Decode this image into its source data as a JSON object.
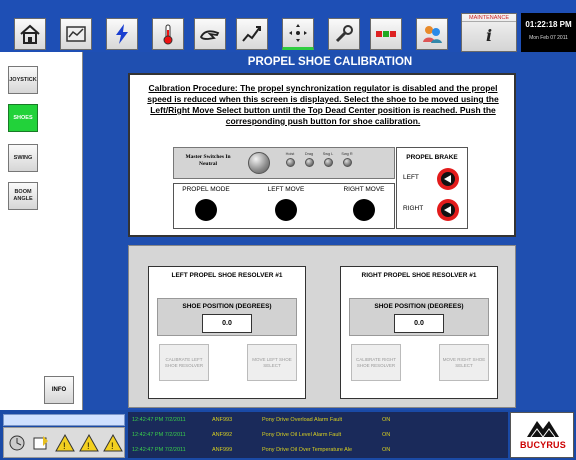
{
  "toolbar": {
    "buttons": [
      "home-icon",
      "chart-panel-icon",
      "lightning-icon",
      "thermometer-icon",
      "hand-icon",
      "trend-icon",
      "move-arrows-icon",
      "wrench-icon",
      "signal-lights-icon",
      "people-icon"
    ],
    "maintenance_label": "MAINTENANCE",
    "info_glyph": "i",
    "time": "01:22:18 PM",
    "date": "Mon Feb 07 2011"
  },
  "sidebar": {
    "items": [
      {
        "label": "JOYSTICK",
        "active": false
      },
      {
        "label": "SHOES",
        "active": true
      },
      {
        "label": "SWING",
        "active": false
      },
      {
        "label": "BOOM ANGLE",
        "active": false
      }
    ],
    "info_label": "INFO"
  },
  "page": {
    "title": "PROPEL SHOE CALIBRATION",
    "procedure": "Calbration Procedure: The propel synchronization regulator is disabled and the propel speed is reduced when this screen is displayed. Select the shoe to be moved using the Left/Right Move Select button until the Top Dead Center position is reached. Push the corresponding push button for shoe calibration."
  },
  "master": {
    "label": "Master Switches In Neutral",
    "lamps": [
      "Hoist",
      "Drag",
      "Swg L",
      "Swg R"
    ]
  },
  "modes": {
    "propel_mode": "PROPEL MODE",
    "left_move": "LEFT MOVE",
    "right_move": "RIGHT MOVE"
  },
  "brake": {
    "title": "PROPEL BRAKE",
    "left": "LEFT",
    "right": "RIGHT"
  },
  "resolvers": {
    "left": {
      "title": "LEFT PROPEL SHOE RESOLVER #1",
      "pos_label": "SHOE POSITION (DEGREES)",
      "value": "0.0",
      "calibrate": "CALIBRATE LEFT SHOE RESOLVER",
      "move": "MOVE LEFT SHOE SELECT"
    },
    "right": {
      "title": "RIGHT PROPEL SHOE RESOLVER #1",
      "pos_label": "SHOE POSITION (DEGREES)",
      "value": "0.0",
      "calibrate": "CALIBRATE RIGHT SHOE RESOLVER",
      "move": "MOVE RIGHT SHOE SELECT"
    }
  },
  "alarms": [
    {
      "time": "12:42:47 PM 7/2/2011",
      "code": "ANF993",
      "text": "Pony Drive Overload Alarm Fault",
      "state": "ON"
    },
    {
      "time": "12:42:47 PM 7/2/2011",
      "code": "ANF992",
      "text": "Pony Drive Oil Level Alarm Fault",
      "state": "ON"
    },
    {
      "time": "12:42:47 PM 7/2/2011",
      "code": "ANF999",
      "text": "Pony Drive Oil Over Temperature Ale",
      "state": "ON"
    }
  ],
  "logo": {
    "text": "BUCYRUS"
  },
  "colors": {
    "accent_green": "#22d23a",
    "background_blue": "#1f4fb0",
    "brake_red": "#e21b1b",
    "alarm_text": "#d8d020",
    "alarm_time": "#3ad04a"
  }
}
